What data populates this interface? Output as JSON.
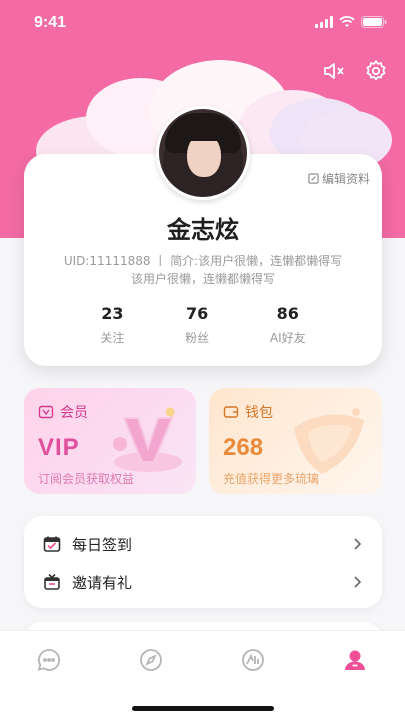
{
  "status_bar": {
    "time": "9:41"
  },
  "header": {
    "icons": [
      "speaker-icon",
      "gear-icon"
    ]
  },
  "profile": {
    "edit_label": "编辑资料",
    "name": "金志炫",
    "bio_line1": "UID:11111888 丨 简介:该用户很懒，连懒都懒得写",
    "bio_line2": "该用户很懒，连懒都懒得写",
    "stats": [
      {
        "value": "23",
        "label": "关注"
      },
      {
        "value": "76",
        "label": "粉丝"
      },
      {
        "value": "86",
        "label": "AI好友"
      }
    ]
  },
  "cards": {
    "vip": {
      "title": "会员",
      "big": "VIP",
      "sub": "订阅会员获取权益"
    },
    "wallet": {
      "title": "钱包",
      "big": "268",
      "sub": "充值获得更多琉璃"
    }
  },
  "menu": {
    "items": [
      {
        "label": "每日签到",
        "icon": "calendar-icon"
      },
      {
        "label": "邀请有礼",
        "icon": "gift-icon"
      }
    ]
  },
  "tabbar": {
    "tabs": [
      "chat-icon",
      "compass-icon",
      "ai-icon",
      "profile-icon"
    ],
    "active": "profile-icon"
  },
  "colors": {
    "hero": "#f36aa4",
    "vip_accent": "#e04f9d",
    "wallet_accent": "#e98a3b",
    "tab_active": "#ee4f98"
  }
}
